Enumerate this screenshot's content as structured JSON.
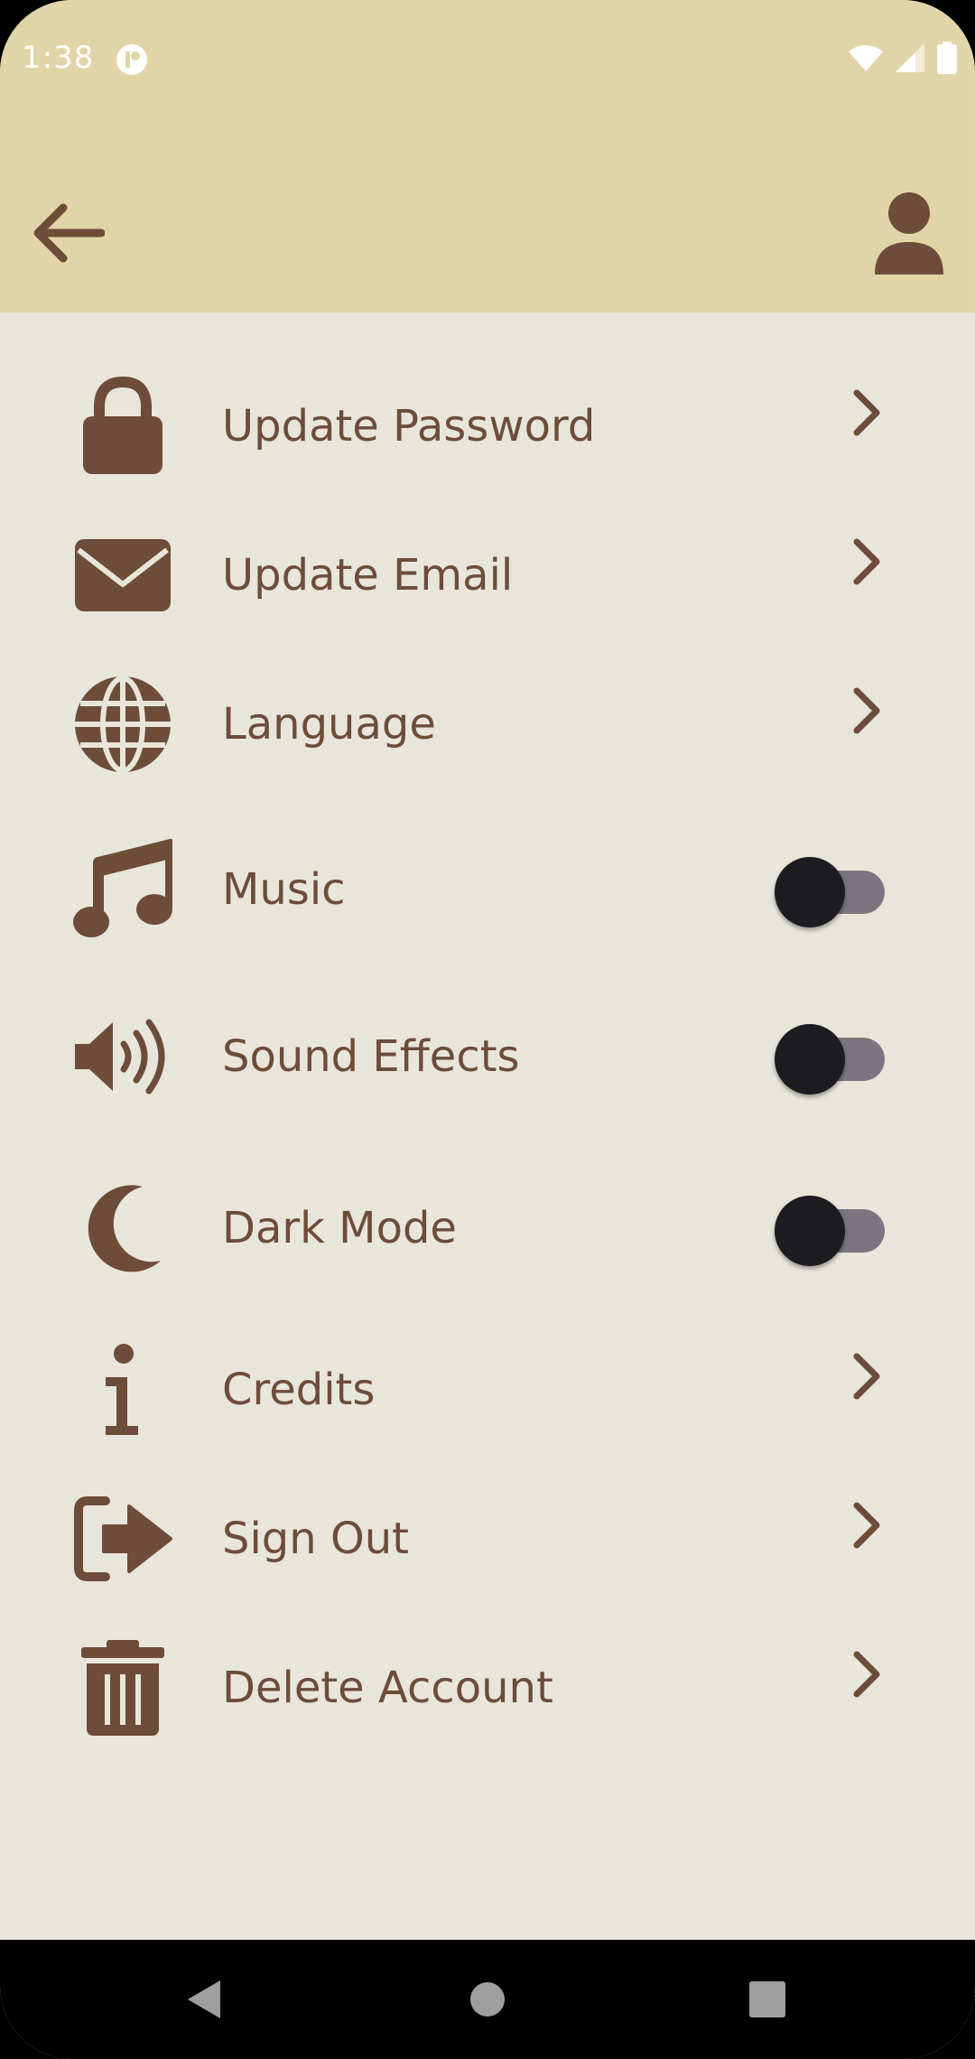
{
  "status_bar": {
    "time": "1:38"
  },
  "colors": {
    "appbar": "#e1d4a6",
    "background": "#e8e6da",
    "accent": "#6e4c3a",
    "toggle_track": "#7b7580",
    "toggle_thumb": "#1d1c21"
  },
  "settings": {
    "update_password": {
      "label": "Update Password",
      "icon": "lock-icon"
    },
    "update_email": {
      "label": "Update Email",
      "icon": "envelope-icon"
    },
    "language": {
      "label": "Language",
      "icon": "globe-icon"
    },
    "music": {
      "label": "Music",
      "icon": "music-note-icon",
      "toggle_on": false
    },
    "sound_effects": {
      "label": "Sound Effects",
      "icon": "speaker-icon",
      "toggle_on": false
    },
    "dark_mode": {
      "label": "Dark Mode",
      "icon": "moon-icon",
      "toggle_on": false
    },
    "credits": {
      "label": "Credits",
      "icon": "info-icon"
    },
    "sign_out": {
      "label": "Sign Out",
      "icon": "sign-out-icon"
    },
    "delete_account": {
      "label": "Delete Account",
      "icon": "trash-icon"
    }
  }
}
